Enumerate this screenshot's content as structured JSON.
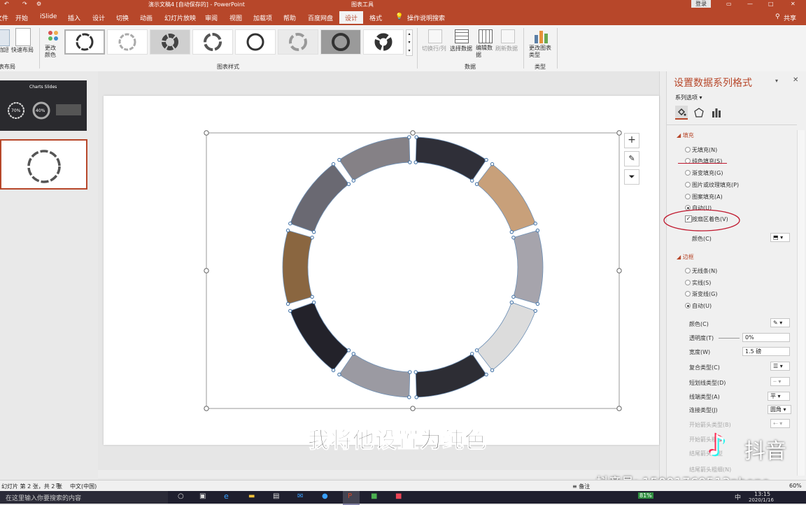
{
  "titlebar": {
    "doc_title": "演示文稿4 [自动保存的] - PowerPoint",
    "context_label": "图表工具",
    "login_button": "登录"
  },
  "tabs": [
    "文件",
    "开始",
    "iSlide",
    "插入",
    "设计",
    "切换",
    "动画",
    "幻灯片放映",
    "审阅",
    "视图",
    "加载项",
    "帮助",
    "百度网盘"
  ],
  "context_tabs": {
    "design": "设计",
    "format": "格式"
  },
  "search_hint": "操作说明搜索",
  "share_label": "共享",
  "ribbon": {
    "add_element": "添加图表元素",
    "quick_layout": "快速布局",
    "layouts_group": "图表布局",
    "change_colors": "更改颜色",
    "styles_group": "图表样式",
    "switch_row_col": "切换行/列",
    "select_data": "选择数据",
    "edit_data": "编辑数据",
    "refresh_data": "刷新数据",
    "data_group": "数据",
    "change_type": "更改图表类型",
    "type_group": "类型"
  },
  "thumbnails": {
    "slide1_number": "1",
    "slide1_title": "Charts Slides",
    "slide1_pct_a": "70%",
    "slide1_pct_b": "40%",
    "slide2_number": "2"
  },
  "chart": {
    "segments": [
      {
        "color": "#2f2f38"
      },
      {
        "color": "#c8a07a"
      },
      {
        "color": "#a6a4ac"
      },
      {
        "color": "#dcdcdc"
      },
      {
        "color": "#2d2d34"
      },
      {
        "color": "#9b9aa2"
      },
      {
        "color": "#23222a"
      },
      {
        "color": "#8a6640"
      },
      {
        "color": "#6a6972"
      },
      {
        "color": "#858186"
      }
    ]
  },
  "subtitle": "我将他设置为纯色",
  "watermark": {
    "app": "抖音",
    "id": "抖音号: 15001769513phone"
  },
  "panel": {
    "title": "设置数据系列格式",
    "series_options": "系列选项",
    "fill_header": "填充",
    "fill_options": [
      {
        "label": "无填充(N)",
        "on": false
      },
      {
        "label": "纯色填充(S)",
        "on": false
      },
      {
        "label": "渐变填充(G)",
        "on": false
      },
      {
        "label": "图片或纹理填充(P)",
        "on": false
      },
      {
        "label": "图案填充(A)",
        "on": false
      },
      {
        "label": "自动(U)",
        "on": true
      }
    ],
    "vary_by_point": "按扇区着色(V)",
    "fill_color_label": "颜色(C)",
    "border_header": "边框",
    "border_options": [
      {
        "label": "无线条(N)",
        "on": false
      },
      {
        "label": "实线(S)",
        "on": false
      },
      {
        "label": "渐变线(G)",
        "on": false
      },
      {
        "label": "自动(U)",
        "on": true
      }
    ],
    "border_color_label": "颜色(C)",
    "transparency_label": "透明度(T)",
    "transparency_value": "0%",
    "width_label": "宽度(W)",
    "width_value": "1.5 磅",
    "compound_label": "复合类型(C)",
    "dash_label": "短划线类型(D)",
    "cap_label": "线端类型(A)",
    "cap_value": "平",
    "join_label": "连接类型(J)",
    "join_value": "圆角",
    "begin_arrow_type": "开始箭头类型(B)",
    "begin_arrow_size": "开始箭头粗细",
    "end_arrow_type": "结尾箭头类型",
    "end_arrow_size": "结尾箭头粗细(N)"
  },
  "statusbar": {
    "slide_info": "幻灯片 第 2 张，共 2 张",
    "language": "中文(中国)",
    "notes": "备注",
    "zoom": "60%"
  },
  "taskbar": {
    "search_placeholder": "在这里输入你要搜索的内容",
    "battery": "81%",
    "ime": "中",
    "time": "13:15",
    "date": "2020/1/16"
  }
}
